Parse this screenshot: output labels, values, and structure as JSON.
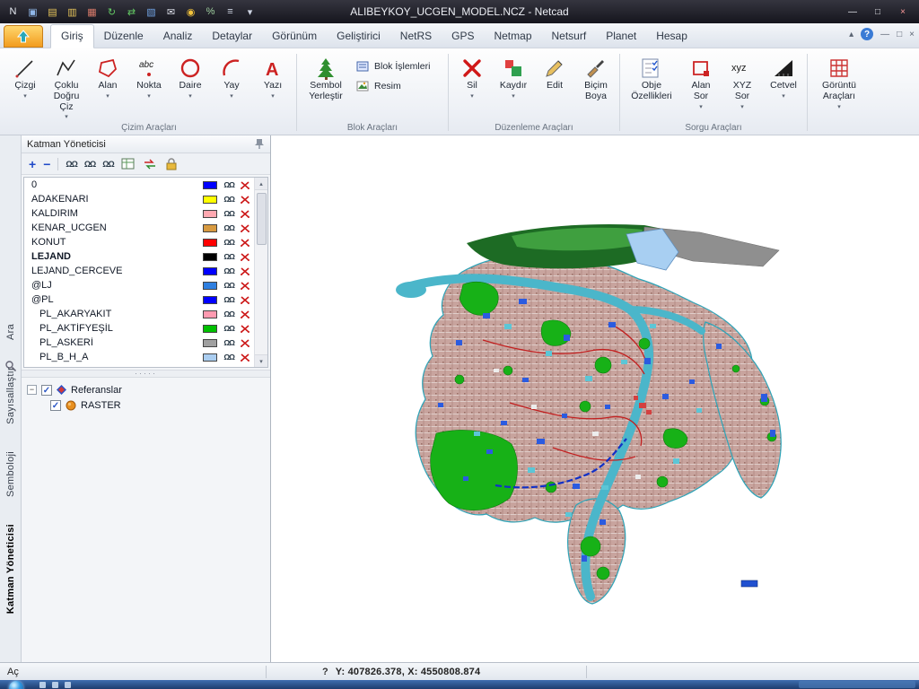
{
  "window": {
    "title": "ALIBEYKOY_UCGEN_MODEL.NCZ - Netcad"
  },
  "icons": {
    "caret": "▾",
    "collapse": "▴",
    "help": "?",
    "minimize": "—",
    "maximize": "□",
    "close": "×",
    "check": "✓",
    "eyes": "ΩΩ",
    "plus": "+",
    "minus": "−",
    "expander": "−",
    "splitter_dots": "·····",
    "scroll_up": "▴",
    "scroll_down": "▾"
  },
  "qat": [
    {
      "name": "netcad-app-icon",
      "glyph": "N",
      "color": "#e8ecf4"
    },
    {
      "name": "monitor-icon",
      "glyph": "▣",
      "color": "#8fb6e8"
    },
    {
      "name": "open-folder-icon",
      "glyph": "▤",
      "color": "#e6c45a"
    },
    {
      "name": "save-icon",
      "glyph": "▥",
      "color": "#e6c45a"
    },
    {
      "name": "print-icon",
      "glyph": "▦",
      "color": "#d87a6a"
    },
    {
      "name": "refresh-icon",
      "glyph": "↻",
      "color": "#63c963"
    },
    {
      "name": "transfer-icon",
      "glyph": "⇄",
      "color": "#63c963"
    },
    {
      "name": "database-icon",
      "glyph": "▧",
      "color": "#6fa0e0"
    },
    {
      "name": "mail-icon",
      "glyph": "✉",
      "color": "#dde0ea"
    },
    {
      "name": "info-icon",
      "glyph": "◉",
      "color": "#f0c23c"
    },
    {
      "name": "percent-icon",
      "glyph": "%",
      "color": "#9fd09f"
    },
    {
      "name": "menu-icon",
      "glyph": "≡",
      "color": "#cfd6e4"
    },
    {
      "name": "qat-dropdown-icon",
      "glyph": "▾",
      "color": "#cfd6e4"
    }
  ],
  "tabs": [
    {
      "label": "Giriş",
      "state": "active"
    },
    {
      "label": "Düzenle"
    },
    {
      "label": "Analiz"
    },
    {
      "label": "Detaylar"
    },
    {
      "label": "Görünüm"
    },
    {
      "label": "Geliştirici"
    },
    {
      "label": "NetRS"
    },
    {
      "label": "GPS"
    },
    {
      "label": "Netmap"
    },
    {
      "label": "Netsurf"
    },
    {
      "label": "Planet"
    },
    {
      "label": "Hesap"
    }
  ],
  "ribbon": {
    "groups": [
      "Çizim Araçları",
      "Blok Araçları",
      "Düzenleme Araçları",
      "Sorgu Araçları"
    ],
    "buttons": {
      "cizgi": "Çizgi",
      "coklu": "Çoklu\nDoğru Çiz",
      "alan": "Alan",
      "nokta": "Nokta",
      "daire": "Daire",
      "yay": "Yay",
      "yazi": "Yazı",
      "sembol": "Sembol\nYerleştir",
      "blok": "Blok İşlemleri",
      "resim": "Resim",
      "sil": "Sil",
      "kaydir": "Kaydır",
      "edit": "Edit",
      "bicim": "Biçim\nBoya",
      "obje": "Obje\nÖzellikleri",
      "alansor": "Alan\nSor",
      "xyzsor": "XYZ\nSor",
      "cetvel": "Cetvel",
      "goruntu": "Görüntü\nAraçları"
    }
  },
  "side_tabs": [
    {
      "name": "side-tab-ara",
      "label": "Ara"
    },
    {
      "name": "side-tab-sayisallastir",
      "label": "Sayısallaştır"
    },
    {
      "name": "side-tab-semboloji",
      "label": "Semboloji"
    },
    {
      "name": "side-tab-katman-yoneticisi",
      "label": "Katman Yöneticisi",
      "state": "active"
    }
  ],
  "layer_panel": {
    "title": "Katman Yöneticisi",
    "layers": [
      {
        "name": "0",
        "color": "#0000ff",
        "weight": "normal",
        "cls": ""
      },
      {
        "name": "ADAKENARI",
        "color": "#ffff00",
        "weight": "normal",
        "cls": ""
      },
      {
        "name": "KALDIRIM",
        "color": "#ffa8b0",
        "weight": "normal",
        "cls": ""
      },
      {
        "name": "KENAR_UCGEN",
        "color": "#d89a40",
        "weight": "normal",
        "cls": ""
      },
      {
        "name": "KONUT",
        "color": "#ff0000",
        "weight": "normal",
        "cls": ""
      },
      {
        "name": "LEJAND",
        "color": "#000000",
        "weight": "bold",
        "cls": ""
      },
      {
        "name": "LEJAND_CERCEVE",
        "color": "#0000ff",
        "weight": "normal",
        "cls": ""
      },
      {
        "name": "@LJ",
        "color": "#2f7fe0",
        "weight": "normal",
        "cls": ""
      },
      {
        "name": "@PL",
        "color": "#0000ff",
        "weight": "normal",
        "cls": ""
      },
      {
        "name": "PL_AKARYAKIT",
        "color": "#ff9ab0",
        "weight": "normal",
        "cls": "indent"
      },
      {
        "name": "PL_AKTİFYEŞİL",
        "color": "#00c000",
        "weight": "normal",
        "cls": "indent"
      },
      {
        "name": "PL_ASKERİ",
        "color": "#a0a0a0",
        "weight": "normal",
        "cls": "indent"
      },
      {
        "name": "PL_B_H_A",
        "color": "#aacdf0",
        "weight": "normal",
        "cls": "indent"
      }
    ],
    "tree": {
      "root": "Referanslar",
      "child": "RASTER"
    }
  },
  "statusbar": {
    "left": "Aç",
    "help": "?",
    "coords": "Y: 407826.378, X: 4550808.874"
  }
}
